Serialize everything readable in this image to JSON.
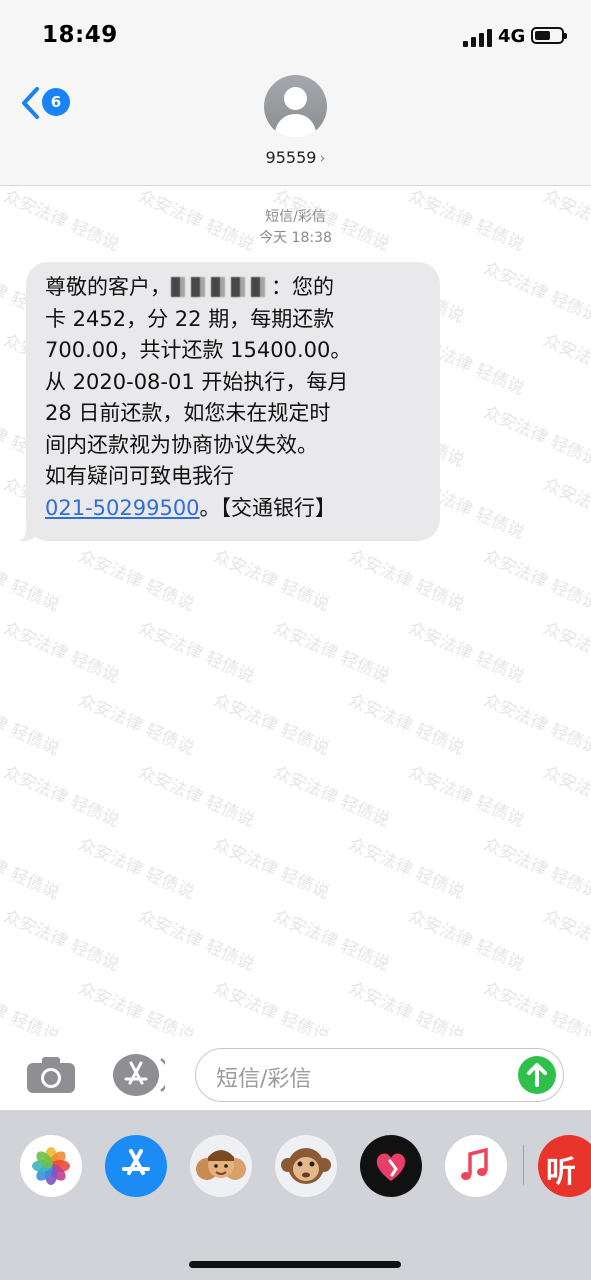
{
  "status_bar": {
    "time": "18:49",
    "network": "4G",
    "signal_bars": 4,
    "battery_level": 0.6
  },
  "header": {
    "back_badge": "6",
    "contact_name": "95559",
    "contact_chevron": "›"
  },
  "conversation": {
    "type_label": "短信/彩信",
    "timestamp": "今天 18:38",
    "message": {
      "lines": [
        {
          "pre": "尊敬的客户，",
          "post": "：您的"
        },
        "卡 2452，分 22 期，每期还款",
        "700.00，共计还款 15400.00。",
        "从 2020-08-01 开始执行，每月",
        "28 日前还款，如您未在规定时",
        "间内还款视为协商协议失效。",
        "如有疑问可致电我行"
      ],
      "phone": "021-50299500",
      "suffix": "。【交通银行】"
    }
  },
  "input": {
    "placeholder": "短信/彩信"
  },
  "watermark_text": "众安法律 轻债说",
  "icons": {
    "back": "chevron-left-icon",
    "avatar": "person-icon",
    "camera": "camera-icon",
    "appstore": "app-store-icon",
    "send": "arrow-up-icon"
  },
  "drawer_apps": [
    {
      "name": "photos-app",
      "icon": "photos-icon"
    },
    {
      "name": "app-store-app",
      "icon": "app-store-icon"
    },
    {
      "name": "memoji-app",
      "icon": "memoji-icon"
    },
    {
      "name": "animoji-app",
      "icon": "monkey-icon"
    },
    {
      "name": "digital-touch-app",
      "icon": "heart-icon"
    },
    {
      "name": "music-app",
      "icon": "music-note-icon"
    },
    {
      "name": "listen-app",
      "icon": "listen-icon",
      "label": "听"
    }
  ],
  "colors": {
    "accent_blue": "#1a82f7",
    "link_blue": "#2f6fd6",
    "bubble_gray": "#e9e9eb",
    "send_green": "#2fbf4b"
  }
}
